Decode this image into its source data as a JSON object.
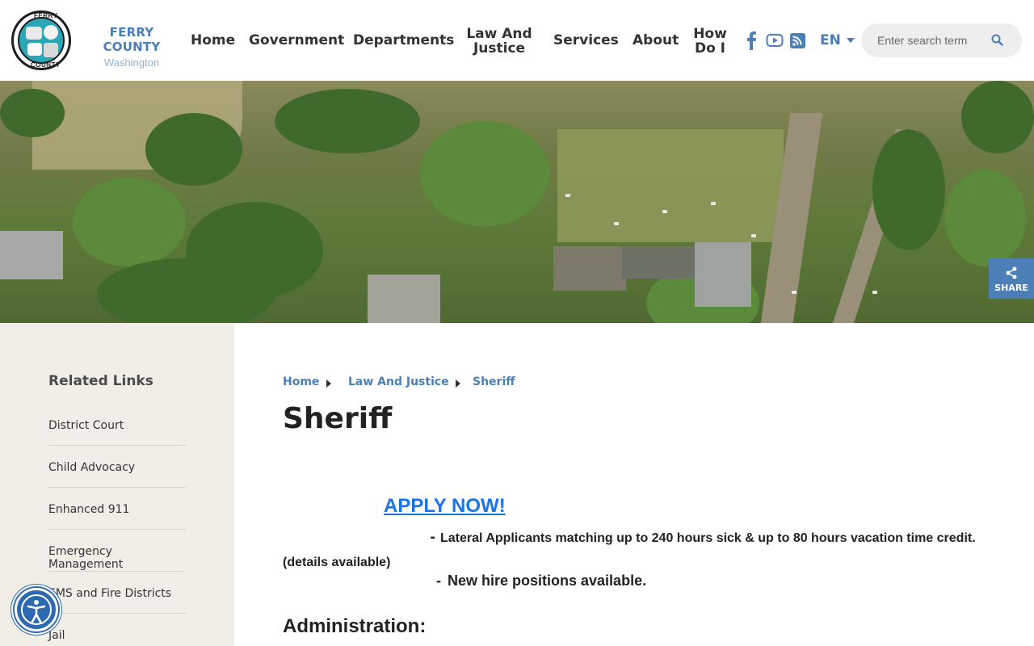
{
  "brand": {
    "name": "FERRY COUNTY",
    "subtitle": "Washington",
    "seal_text_top": "FERRY",
    "seal_text_bottom": "COUNTY"
  },
  "nav": {
    "items": [
      {
        "label": "Home"
      },
      {
        "label": "Government"
      },
      {
        "label": "Departments"
      },
      {
        "label_line1": "Law And",
        "label_line2": "Justice"
      },
      {
        "label": "Services"
      },
      {
        "label": "About"
      },
      {
        "label_line1": "How",
        "label_line2": "Do I"
      }
    ],
    "social_icons": [
      "facebook-icon",
      "youtube-icon",
      "rss-icon"
    ],
    "language": "EN"
  },
  "search": {
    "placeholder": "Enter search terms"
  },
  "share": {
    "label": "SHARE"
  },
  "sidebar": {
    "title": "Related Links",
    "items": [
      "District Court",
      "Child Advocacy",
      "Enhanced 911",
      "Emergency Management",
      "EMS and Fire Districts",
      "Jail"
    ]
  },
  "breadcrumb": [
    "Home",
    "Law And Justice",
    "Sheriff"
  ],
  "main": {
    "title": "Sheriff",
    "apply_link": "APPLY NOW!",
    "line1_dash": "-",
    "line1": "Lateral Applicants matching up to 240 hours sick & up to 80 hours vacation time credit. (details available)",
    "line2_dash": "-",
    "line2": "New hire positions available.",
    "section_heading": "Administration:"
  },
  "colors": {
    "brand_blue": "#4c7fb8",
    "link_blue": "#1a73e8",
    "sidebar_bg": "#f1eee8",
    "accessibility_blue": "#2c69b0"
  }
}
